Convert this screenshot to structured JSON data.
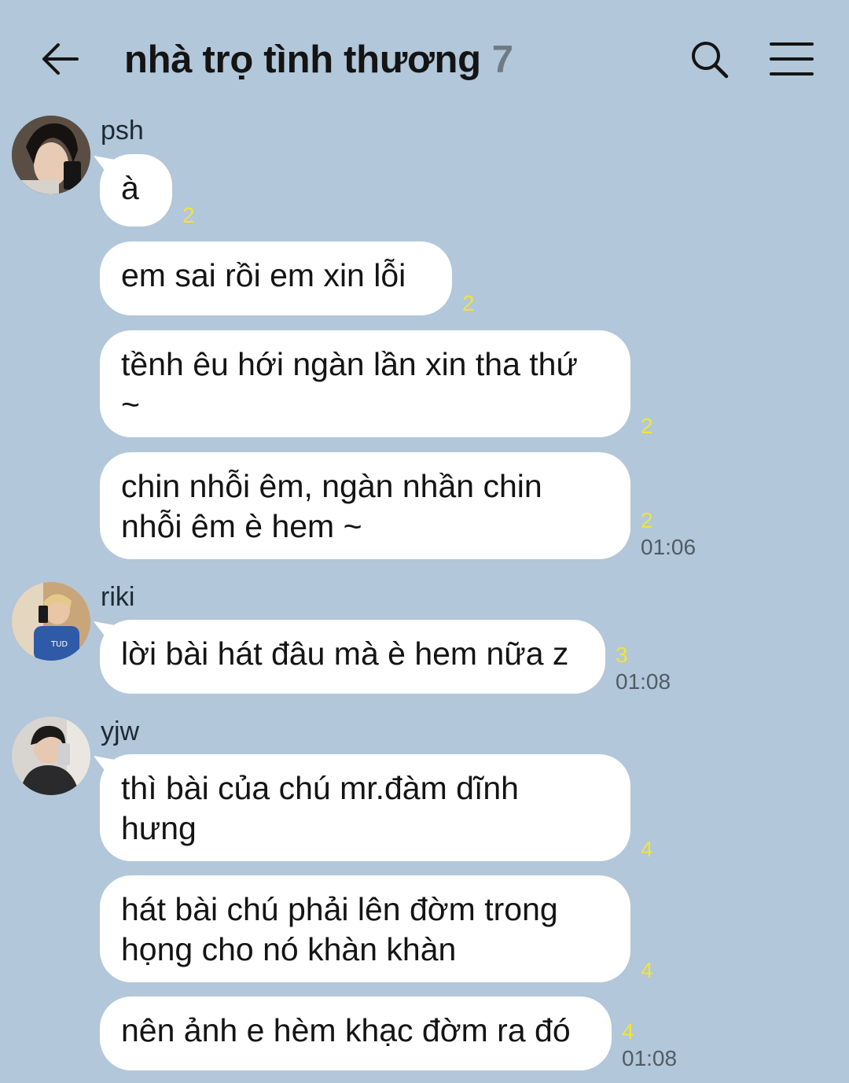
{
  "header": {
    "title": "nhà trọ tình thương",
    "member_count": "7",
    "icons": {
      "back": "arrow-left-icon",
      "search": "search-icon",
      "menu": "hamburger-menu-icon"
    }
  },
  "groups": [
    {
      "sender": "psh",
      "messages": [
        {
          "text": "à",
          "unread": "2",
          "time": ""
        },
        {
          "text": "em sai rồi em xin lỗi",
          "unread": "2",
          "time": ""
        },
        {
          "text": "tềnh êu hới ngàn lần xin tha thứ\n~",
          "unread": "2",
          "time": ""
        },
        {
          "text": "chin nhỗi êm, ngàn nhần chin\nnhỗi êm è hem ~",
          "unread": "2",
          "time": "01:06"
        }
      ]
    },
    {
      "sender": "riki",
      "messages": [
        {
          "text": "lời bài hát đâu mà è hem nữa z",
          "unread": "3",
          "time": "01:08"
        }
      ]
    },
    {
      "sender": "yjw",
      "messages": [
        {
          "text": "thì bài của chú mr.đàm dĩnh\nhưng",
          "unread": "4",
          "time": ""
        },
        {
          "text": "hát bài chú phải lên đờm trong\nhọng cho nó khàn khàn",
          "unread": "4",
          "time": ""
        },
        {
          "text": "nên ảnh e hèm khạc đờm ra đó",
          "unread": "4",
          "time": "01:08"
        }
      ]
    }
  ],
  "colors": {
    "background": "#b2c7d9",
    "bubble": "#ffffff",
    "unread_count": "#f2e33a",
    "member_count": "#6f7b84"
  }
}
